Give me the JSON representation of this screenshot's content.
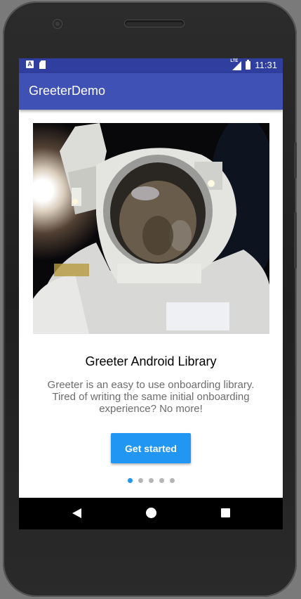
{
  "status_bar": {
    "notif_icon_a": "A",
    "sd_icon": "sd-card-icon",
    "network": "LTE",
    "time": "11:31"
  },
  "app_bar": {
    "title": "GreeterDemo"
  },
  "onboarding": {
    "image": "astronaut-selfie-image",
    "title": "Greeter Android Library",
    "body": "Greeter is an easy to use onboarding library. Tired of writing the same initial onboarding experience? No more!",
    "cta_label": "Get started",
    "page_count": 5,
    "current_page": 1
  },
  "nav_bar": {
    "back_icon": "back-triangle-icon",
    "home_icon": "home-circle-icon",
    "recents_icon": "recents-square-icon"
  },
  "colors": {
    "status_bar": "#303f9f",
    "app_bar": "#3f51b5",
    "accent": "#2196f3"
  }
}
